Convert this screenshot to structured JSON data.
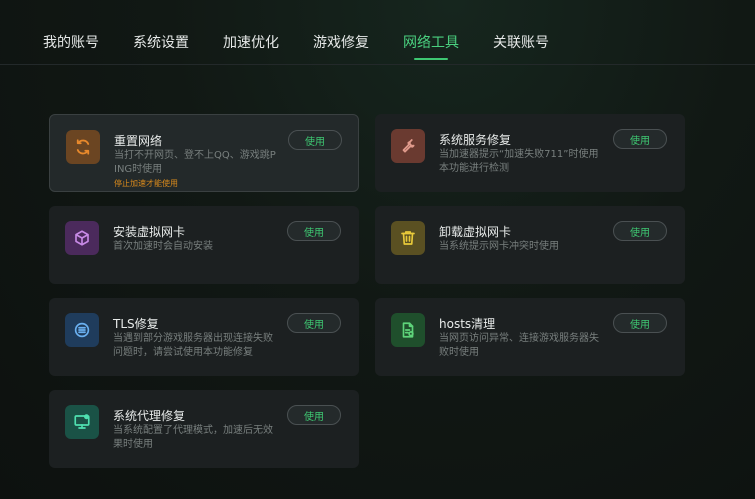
{
  "tabs": [
    {
      "label": "我的账号"
    },
    {
      "label": "系统设置"
    },
    {
      "label": "加速优化"
    },
    {
      "label": "游戏修复"
    },
    {
      "label": "网络工具"
    },
    {
      "label": "关联账号"
    }
  ],
  "active_tab": "网络工具",
  "accent_color": "#3ec872",
  "cards": [
    {
      "title": "重置网络",
      "desc": "当打不开网页、登不上QQ、游戏跳PING时使用",
      "warning": "停止加速才能使用",
      "button": "使用",
      "icon": "refresh-icon",
      "icon_color": "#e8892c",
      "icon_bg": "#6b4522"
    },
    {
      "title": "系统服务修复",
      "desc": "当加速器提示“加速失败711”时使用本功能进行检测",
      "button": "使用",
      "icon": "wrench-icon",
      "icon_color": "#e09a8c",
      "icon_bg": "#6a3a30"
    },
    {
      "title": "安装虚拟网卡",
      "desc": "首次加速时会自动安装",
      "button": "使用",
      "icon": "cube-icon",
      "icon_color": "#c88ae6",
      "icon_bg": "#4b2a5c"
    },
    {
      "title": "卸载虚拟网卡",
      "desc": "当系统提示网卡冲突时使用",
      "button": "使用",
      "icon": "trash-icon",
      "icon_color": "#e8c93a",
      "icon_bg": "#5a5022"
    },
    {
      "title": "TLS修复",
      "desc": "当遇到部分游戏服务器出现连接失败问题时，请尝试使用本功能修复",
      "button": "使用",
      "icon": "tls-icon",
      "icon_color": "#6ab0f0",
      "icon_bg": "#1f3c5c"
    },
    {
      "title": "hosts清理",
      "desc": "当网页访问异常、连接游戏服务器失败时使用",
      "button": "使用",
      "icon": "file-clean-icon",
      "icon_color": "#5ed47a",
      "icon_bg": "#1f4f2c"
    },
    {
      "title": "系统代理修复",
      "desc": "当系统配置了代理模式，加速后无效果时使用",
      "button": "使用",
      "icon": "monitor-icon",
      "icon_color": "#4fe0b0",
      "icon_bg": "#1a5246"
    }
  ]
}
